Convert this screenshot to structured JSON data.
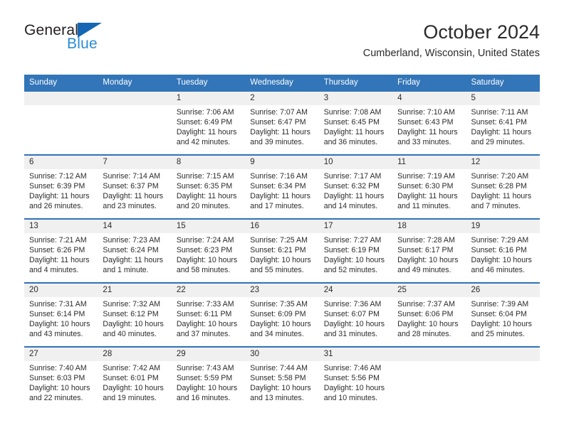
{
  "brand": {
    "line1": "General",
    "line2": "Blue",
    "triangle_color": "#1567b3",
    "line2_color": "#2a8bd5"
  },
  "header": {
    "title": "October 2024",
    "location": "Cumberland, Wisconsin, United States"
  },
  "theme": {
    "header_bg": "#3275b8",
    "row_divider": "#2f74b5",
    "daynum_bg": "#f0f0f0",
    "text": "#2b2b2b"
  },
  "calendar": {
    "weekday_headers": [
      "Sunday",
      "Monday",
      "Tuesday",
      "Wednesday",
      "Thursday",
      "Friday",
      "Saturday"
    ],
    "weeks": [
      [
        {
          "day": "",
          "lines": []
        },
        {
          "day": "",
          "lines": []
        },
        {
          "day": "1",
          "lines": [
            "Sunrise: 7:06 AM",
            "Sunset: 6:49 PM",
            "Daylight: 11 hours",
            "and 42 minutes."
          ]
        },
        {
          "day": "2",
          "lines": [
            "Sunrise: 7:07 AM",
            "Sunset: 6:47 PM",
            "Daylight: 11 hours",
            "and 39 minutes."
          ]
        },
        {
          "day": "3",
          "lines": [
            "Sunrise: 7:08 AM",
            "Sunset: 6:45 PM",
            "Daylight: 11 hours",
            "and 36 minutes."
          ]
        },
        {
          "day": "4",
          "lines": [
            "Sunrise: 7:10 AM",
            "Sunset: 6:43 PM",
            "Daylight: 11 hours",
            "and 33 minutes."
          ]
        },
        {
          "day": "5",
          "lines": [
            "Sunrise: 7:11 AM",
            "Sunset: 6:41 PM",
            "Daylight: 11 hours",
            "and 29 minutes."
          ]
        }
      ],
      [
        {
          "day": "6",
          "lines": [
            "Sunrise: 7:12 AM",
            "Sunset: 6:39 PM",
            "Daylight: 11 hours",
            "and 26 minutes."
          ]
        },
        {
          "day": "7",
          "lines": [
            "Sunrise: 7:14 AM",
            "Sunset: 6:37 PM",
            "Daylight: 11 hours",
            "and 23 minutes."
          ]
        },
        {
          "day": "8",
          "lines": [
            "Sunrise: 7:15 AM",
            "Sunset: 6:35 PM",
            "Daylight: 11 hours",
            "and 20 minutes."
          ]
        },
        {
          "day": "9",
          "lines": [
            "Sunrise: 7:16 AM",
            "Sunset: 6:34 PM",
            "Daylight: 11 hours",
            "and 17 minutes."
          ]
        },
        {
          "day": "10",
          "lines": [
            "Sunrise: 7:17 AM",
            "Sunset: 6:32 PM",
            "Daylight: 11 hours",
            "and 14 minutes."
          ]
        },
        {
          "day": "11",
          "lines": [
            "Sunrise: 7:19 AM",
            "Sunset: 6:30 PM",
            "Daylight: 11 hours",
            "and 11 minutes."
          ]
        },
        {
          "day": "12",
          "lines": [
            "Sunrise: 7:20 AM",
            "Sunset: 6:28 PM",
            "Daylight: 11 hours",
            "and 7 minutes."
          ]
        }
      ],
      [
        {
          "day": "13",
          "lines": [
            "Sunrise: 7:21 AM",
            "Sunset: 6:26 PM",
            "Daylight: 11 hours",
            "and 4 minutes."
          ]
        },
        {
          "day": "14",
          "lines": [
            "Sunrise: 7:23 AM",
            "Sunset: 6:24 PM",
            "Daylight: 11 hours",
            "and 1 minute."
          ]
        },
        {
          "day": "15",
          "lines": [
            "Sunrise: 7:24 AM",
            "Sunset: 6:23 PM",
            "Daylight: 10 hours",
            "and 58 minutes."
          ]
        },
        {
          "day": "16",
          "lines": [
            "Sunrise: 7:25 AM",
            "Sunset: 6:21 PM",
            "Daylight: 10 hours",
            "and 55 minutes."
          ]
        },
        {
          "day": "17",
          "lines": [
            "Sunrise: 7:27 AM",
            "Sunset: 6:19 PM",
            "Daylight: 10 hours",
            "and 52 minutes."
          ]
        },
        {
          "day": "18",
          "lines": [
            "Sunrise: 7:28 AM",
            "Sunset: 6:17 PM",
            "Daylight: 10 hours",
            "and 49 minutes."
          ]
        },
        {
          "day": "19",
          "lines": [
            "Sunrise: 7:29 AM",
            "Sunset: 6:16 PM",
            "Daylight: 10 hours",
            "and 46 minutes."
          ]
        }
      ],
      [
        {
          "day": "20",
          "lines": [
            "Sunrise: 7:31 AM",
            "Sunset: 6:14 PM",
            "Daylight: 10 hours",
            "and 43 minutes."
          ]
        },
        {
          "day": "21",
          "lines": [
            "Sunrise: 7:32 AM",
            "Sunset: 6:12 PM",
            "Daylight: 10 hours",
            "and 40 minutes."
          ]
        },
        {
          "day": "22",
          "lines": [
            "Sunrise: 7:33 AM",
            "Sunset: 6:11 PM",
            "Daylight: 10 hours",
            "and 37 minutes."
          ]
        },
        {
          "day": "23",
          "lines": [
            "Sunrise: 7:35 AM",
            "Sunset: 6:09 PM",
            "Daylight: 10 hours",
            "and 34 minutes."
          ]
        },
        {
          "day": "24",
          "lines": [
            "Sunrise: 7:36 AM",
            "Sunset: 6:07 PM",
            "Daylight: 10 hours",
            "and 31 minutes."
          ]
        },
        {
          "day": "25",
          "lines": [
            "Sunrise: 7:37 AM",
            "Sunset: 6:06 PM",
            "Daylight: 10 hours",
            "and 28 minutes."
          ]
        },
        {
          "day": "26",
          "lines": [
            "Sunrise: 7:39 AM",
            "Sunset: 6:04 PM",
            "Daylight: 10 hours",
            "and 25 minutes."
          ]
        }
      ],
      [
        {
          "day": "27",
          "lines": [
            "Sunrise: 7:40 AM",
            "Sunset: 6:03 PM",
            "Daylight: 10 hours",
            "and 22 minutes."
          ]
        },
        {
          "day": "28",
          "lines": [
            "Sunrise: 7:42 AM",
            "Sunset: 6:01 PM",
            "Daylight: 10 hours",
            "and 19 minutes."
          ]
        },
        {
          "day": "29",
          "lines": [
            "Sunrise: 7:43 AM",
            "Sunset: 5:59 PM",
            "Daylight: 10 hours",
            "and 16 minutes."
          ]
        },
        {
          "day": "30",
          "lines": [
            "Sunrise: 7:44 AM",
            "Sunset: 5:58 PM",
            "Daylight: 10 hours",
            "and 13 minutes."
          ]
        },
        {
          "day": "31",
          "lines": [
            "Sunrise: 7:46 AM",
            "Sunset: 5:56 PM",
            "Daylight: 10 hours",
            "and 10 minutes."
          ]
        },
        {
          "day": "",
          "lines": []
        },
        {
          "day": "",
          "lines": []
        }
      ]
    ]
  }
}
